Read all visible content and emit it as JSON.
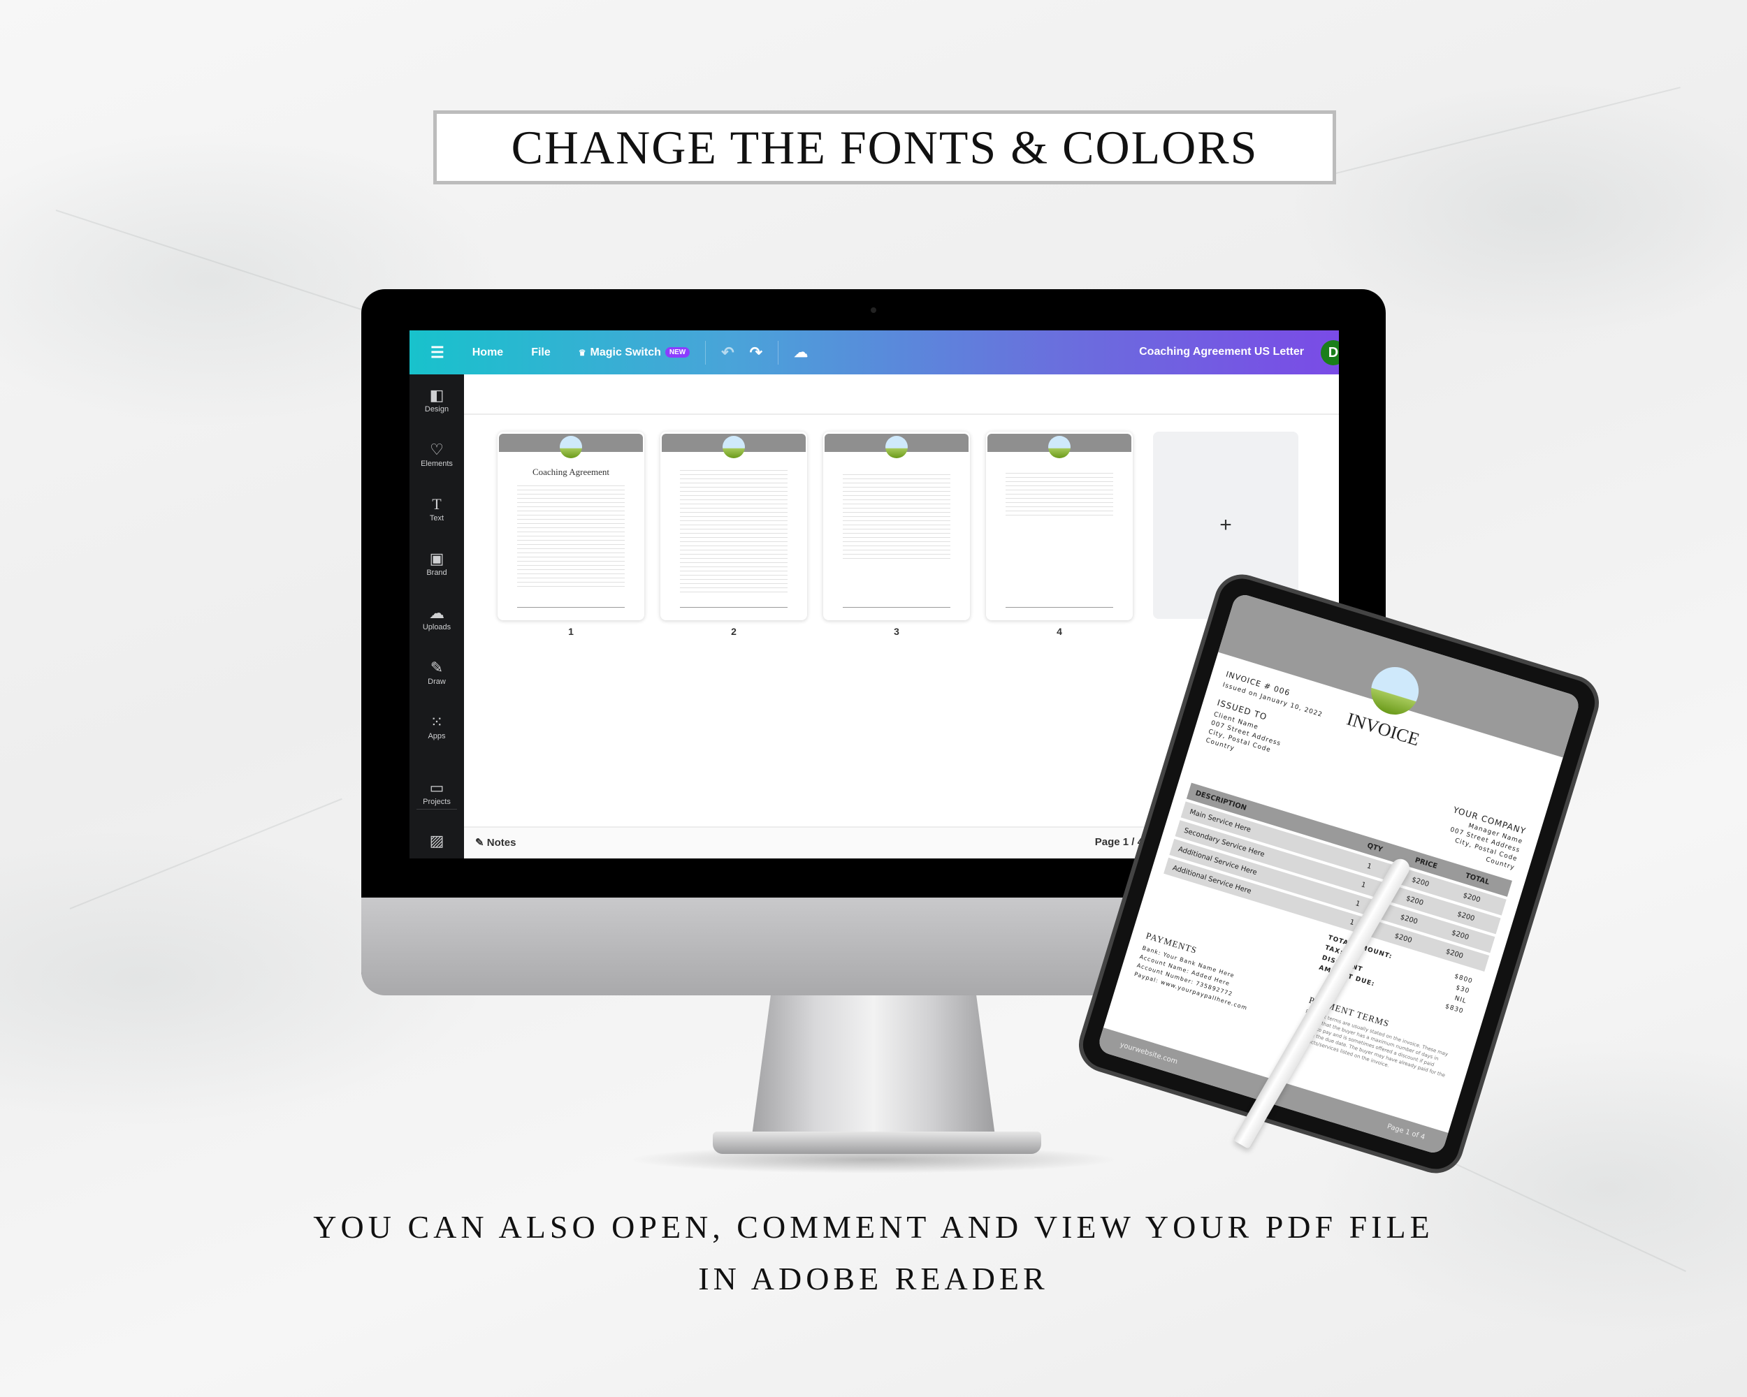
{
  "headline": "CHANGE THE FONTS & COLORS",
  "caption": {
    "line1": "YOU CAN ALSO OPEN, COMMENT AND VIEW YOUR PDF FILE",
    "line2": "IN ADOBE READER"
  },
  "editor": {
    "topbar": {
      "menu_icon": "☰",
      "home": "Home",
      "file": "File",
      "magic_switch_icon": "♛",
      "magic_switch": "Magic Switch",
      "new_badge": "NEW",
      "undo_icon": "↶",
      "redo_icon": "↷",
      "cloud_icon": "☁",
      "document_title": "Coaching Agreement US Letter",
      "avatar_initial": "D",
      "gradient_start": "#18c2cc",
      "gradient_end": "#7a4be6"
    },
    "sidebar": [
      {
        "icon": "◧",
        "label": "Design"
      },
      {
        "icon": "♡",
        "label": "Elements"
      },
      {
        "icon": "T",
        "label": "Text"
      },
      {
        "icon": "▣",
        "label": "Brand"
      },
      {
        "icon": "☁",
        "label": "Uploads"
      },
      {
        "icon": "✎",
        "label": "Draw"
      },
      {
        "icon": "⁙",
        "label": "Apps"
      },
      {
        "icon": "▭",
        "label": "Projects"
      },
      {
        "icon": "▨",
        "label": ""
      }
    ],
    "pages": [
      {
        "number": "1",
        "title": "Coaching Agreement"
      },
      {
        "number": "2",
        "title": ""
      },
      {
        "number": "3",
        "title": ""
      },
      {
        "number": "4",
        "title": ""
      }
    ],
    "add_page_icon": "+",
    "notes_icon": "✎",
    "notes_label": "Notes",
    "page_indicator": "Page 1 / 4"
  },
  "invoice": {
    "title": "INVOICE",
    "number": "INVOICE # 006",
    "issued_on": "Issued on January 10, 2022",
    "issued_to_label": "ISSUED TO",
    "client": [
      "Client Name",
      "007 Street Address",
      "City, Postal Code",
      "Country"
    ],
    "company_label": "YOUR COMPANY",
    "company": [
      "Manager Name",
      "007 Street Address",
      "City, Postal Code",
      "Country"
    ],
    "table": {
      "headers": [
        "DESCRIPTION",
        "QTY",
        "PRICE",
        "TOTAL"
      ],
      "rows": [
        [
          "Main Service Here",
          "1",
          "$200",
          "$200"
        ],
        [
          "Secondary Service Here",
          "1",
          "$200",
          "$200"
        ],
        [
          "Additional Service Here",
          "1",
          "$200",
          "$200"
        ],
        [
          "Additional Service Here",
          "1",
          "$200",
          "$200"
        ]
      ]
    },
    "totals": [
      {
        "label": "TOTAL AMOUNT:",
        "value": "$800"
      },
      {
        "label": "TAX:",
        "value": "$30"
      },
      {
        "label": "DISCOUNT",
        "value": "NIL"
      },
      {
        "label": "AMOUNT DUE:",
        "value": "$830"
      }
    ],
    "payments_label": "PAYMENTS",
    "payments": [
      "Bank: Your Bank Name Here",
      "Account Name: Added Here",
      "Account Number: 735892772",
      "Paypal: www.yourpaypalIhere.com"
    ],
    "terms_label": "PAYMENT TERMS",
    "terms_text": "Payment terms are usually stated on the invoice. These may specify that the buyer has a maximum number of days in which to pay and is sometimes offered a discount if paid before the due date. The buyer may have already paid for the products/services listed on the invoice.",
    "website": "yourwebsite.com",
    "page": "Page 1 of 4"
  }
}
